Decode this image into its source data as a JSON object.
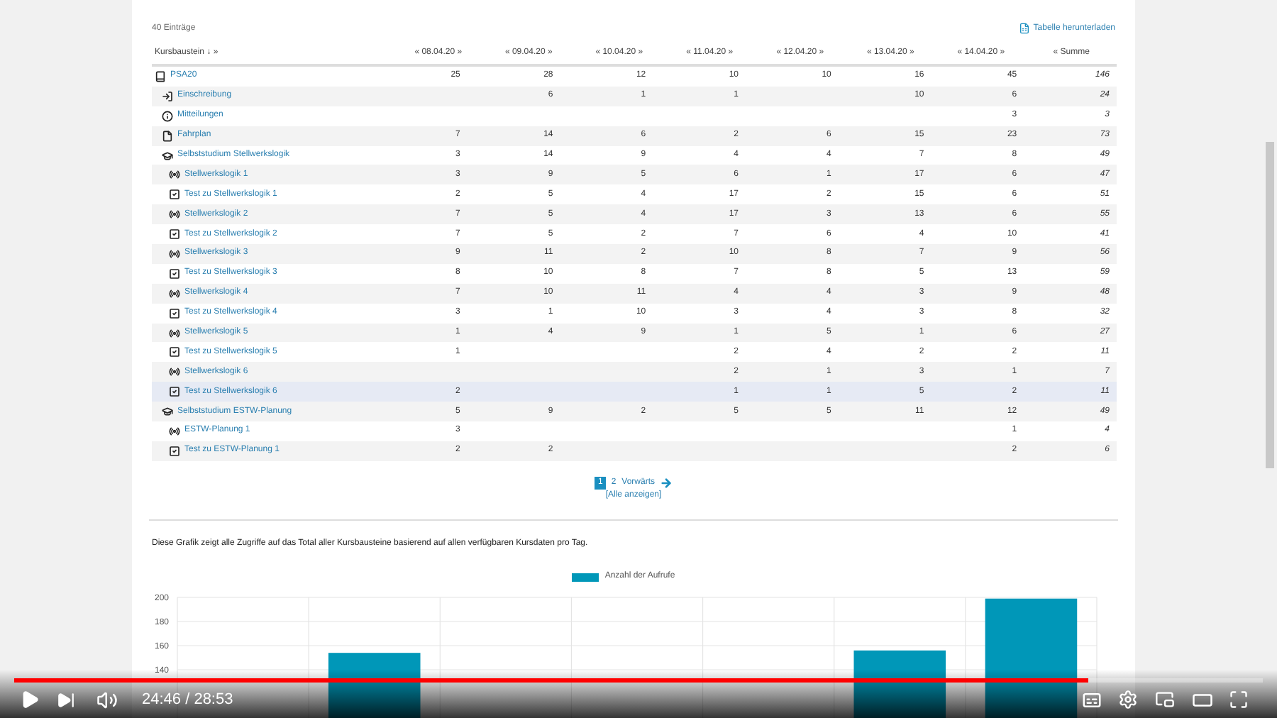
{
  "summary": {
    "count": "40 Einträge",
    "download": "Tabelle herunterladen"
  },
  "table": {
    "columns": [
      "Kursbaustein ↓ »",
      "« 08.04.20 »",
      "« 09.04.20 »",
      "« 10.04.20 »",
      "« 11.04.20 »",
      "« 12.04.20 »",
      "« 13.04.20 »",
      "« 14.04.20 »",
      "« Summe"
    ],
    "rows": [
      {
        "kind": "course",
        "name": "PSA20",
        "highlighted": false,
        "values": {
          "day_1": "25",
          "day_2": "28",
          "day_3": "12",
          "day_4": "10",
          "day_5": "10",
          "day_6": "16",
          "day_7": "45",
          "total": "146"
        },
        "children": [
          {
            "kind": "enrollment",
            "name": "Einschreibung",
            "highlighted": false,
            "values": {
              "day_2": "6",
              "day_3": "1",
              "day_4": "1",
              "day_6": "10",
              "day_7": "6",
              "total": "24"
            }
          },
          {
            "kind": "info",
            "name": "Mitteilungen",
            "highlighted": false,
            "values": {
              "day_7": "3",
              "total": "3"
            }
          },
          {
            "kind": "document",
            "name": "Fahrplan",
            "highlighted": false,
            "values": {
              "day_1": "7",
              "day_2": "14",
              "day_3": "6",
              "day_4": "2",
              "day_5": "6",
              "day_6": "15",
              "day_7": "23",
              "total": "73"
            }
          },
          {
            "kind": "study",
            "name": "Selbststudium Stellwerkslogik",
            "highlighted": false,
            "values": {
              "day_1": "3",
              "day_2": "14",
              "day_3": "9",
              "day_4": "4",
              "day_5": "4",
              "day_6": "7",
              "day_7": "8",
              "total": "49"
            },
            "children": [
              {
                "kind": "module",
                "name": "Stellwerkslogik 1",
                "highlighted": false,
                "values": {
                  "day_1": "3",
                  "day_2": "9",
                  "day_3": "5",
                  "day_4": "6",
                  "day_5": "1",
                  "day_6": "17",
                  "day_7": "6",
                  "total": "47"
                }
              },
              {
                "kind": "test",
                "name": "Test zu Stellwerkslogik 1",
                "highlighted": false,
                "values": {
                  "day_1": "2",
                  "day_2": "5",
                  "day_3": "4",
                  "day_4": "17",
                  "day_5": "2",
                  "day_6": "15",
                  "day_7": "6",
                  "total": "51"
                }
              },
              {
                "kind": "module",
                "name": "Stellwerkslogik 2",
                "highlighted": false,
                "values": {
                  "day_1": "7",
                  "day_2": "5",
                  "day_3": "4",
                  "day_4": "17",
                  "day_5": "3",
                  "day_6": "13",
                  "day_7": "6",
                  "total": "55"
                }
              },
              {
                "kind": "test",
                "name": "Test zu Stellwerkslogik 2",
                "highlighted": false,
                "values": {
                  "day_1": "7",
                  "day_2": "5",
                  "day_3": "2",
                  "day_4": "7",
                  "day_5": "6",
                  "day_6": "4",
                  "day_7": "10",
                  "total": "41"
                }
              },
              {
                "kind": "module",
                "name": "Stellwerkslogik 3",
                "highlighted": false,
                "values": {
                  "day_1": "9",
                  "day_2": "11",
                  "day_3": "2",
                  "day_4": "10",
                  "day_5": "8",
                  "day_6": "7",
                  "day_7": "9",
                  "total": "56"
                }
              },
              {
                "kind": "test",
                "name": "Test zu Stellwerkslogik 3",
                "highlighted": false,
                "values": {
                  "day_1": "8",
                  "day_2": "10",
                  "day_3": "8",
                  "day_4": "7",
                  "day_5": "8",
                  "day_6": "5",
                  "day_7": "13",
                  "total": "59"
                }
              },
              {
                "kind": "module",
                "name": "Stellwerkslogik 4",
                "highlighted": false,
                "values": {
                  "day_1": "7",
                  "day_2": "10",
                  "day_3": "11",
                  "day_4": "4",
                  "day_5": "4",
                  "day_6": "3",
                  "day_7": "9",
                  "total": "48"
                }
              },
              {
                "kind": "test",
                "name": "Test zu Stellwerkslogik 4",
                "highlighted": false,
                "values": {
                  "day_1": "3",
                  "day_2": "1",
                  "day_3": "10",
                  "day_4": "3",
                  "day_5": "4",
                  "day_6": "3",
                  "day_7": "8",
                  "total": "32"
                }
              },
              {
                "kind": "module",
                "name": "Stellwerkslogik 5",
                "highlighted": false,
                "values": {
                  "day_1": "1",
                  "day_2": "4",
                  "day_3": "9",
                  "day_4": "1",
                  "day_5": "5",
                  "day_6": "1",
                  "day_7": "6",
                  "total": "27"
                }
              },
              {
                "kind": "test",
                "name": "Test zu Stellwerkslogik 5",
                "highlighted": false,
                "values": {
                  "day_1": "1",
                  "day_4": "2",
                  "day_5": "4",
                  "day_6": "2",
                  "day_7": "2",
                  "total": "11"
                }
              },
              {
                "kind": "module",
                "name": "Stellwerkslogik 6",
                "highlighted": false,
                "values": {
                  "day_4": "2",
                  "day_5": "1",
                  "day_6": "3",
                  "day_7": "1",
                  "total": "7"
                }
              },
              {
                "kind": "test",
                "name": "Test zu Stellwerkslogik 6",
                "highlighted": true,
                "values": {
                  "day_1": "2",
                  "day_4": "1",
                  "day_5": "1",
                  "day_6": "5",
                  "day_7": "2",
                  "total": "11"
                }
              }
            ]
          },
          {
            "kind": "study",
            "name": "Selbststudium ESTW-Planung",
            "highlighted": false,
            "values": {
              "day_1": "5",
              "day_2": "9",
              "day_3": "2",
              "day_4": "5",
              "day_5": "5",
              "day_6": "11",
              "day_7": "12",
              "total": "49"
            },
            "children": [
              {
                "kind": "module",
                "name": "ESTW-Planung 1",
                "highlighted": false,
                "values": {
                  "day_1": "3",
                  "day_7": "1",
                  "total": "4"
                }
              },
              {
                "kind": "test",
                "name": "Test zu ESTW-Planung 1",
                "highlighted": false,
                "values": {
                  "day_1": "2",
                  "day_2": "2",
                  "day_7": "2",
                  "total": "6"
                }
              }
            ]
          }
        ]
      }
    ]
  },
  "pagination": {
    "pages": [
      {
        "label": "1",
        "selected": true
      },
      {
        "label": "2",
        "selected": false
      }
    ],
    "next": "Vorwärts",
    "show_all": "[Alle anzeigen]"
  },
  "chart_description": "Diese Grafik zeigt alle Zugriffe auf das Total aller Kursbausteine basierend auf allen verfügbaren Kursdaten pro Tag.",
  "chart": {
    "chart_data": {
      "type": "bar",
      "series": [
        {
          "name": "Anzahl der Aufrufe",
          "color": "#0097b8",
          "values": [
            null,
            154,
            null,
            null,
            null,
            156,
            199
          ]
        }
      ],
      "ylim": [
        100,
        200
      ],
      "yticks": [
        140,
        160,
        180,
        200
      ],
      "grid": true
    }
  },
  "player": {
    "progress": {
      "level": 0.86
    },
    "time": "24:46 / 28:53"
  }
}
